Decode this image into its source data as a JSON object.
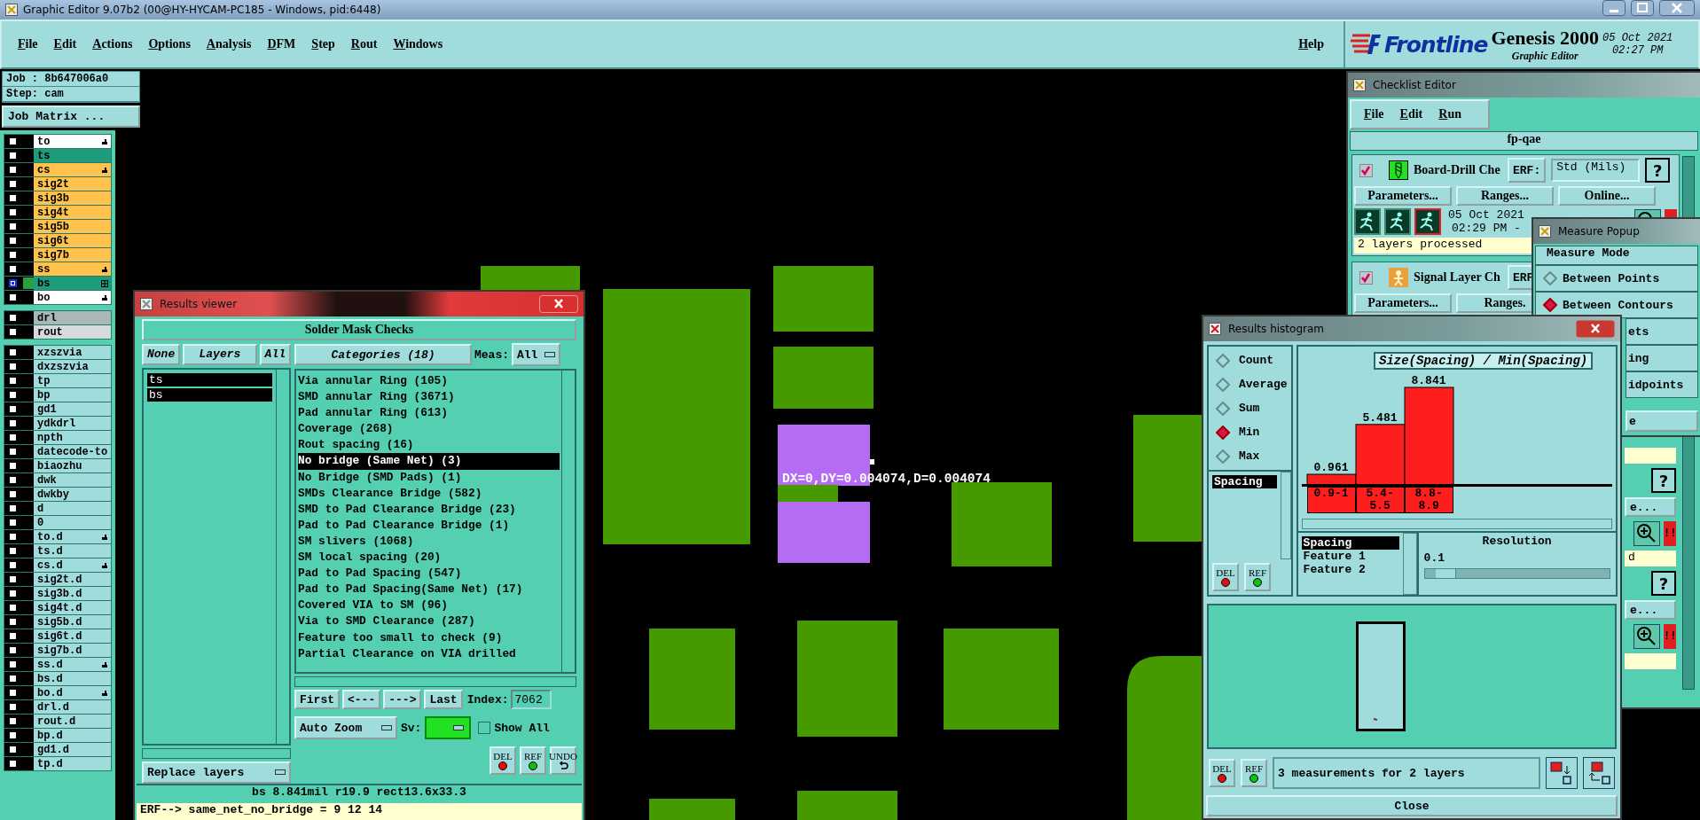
{
  "title_bar": {
    "title": "Graphic Editor 9.07b2 (00@HY-HYCAM-PC185 - Windows, pid:6448)"
  },
  "menu": [
    {
      "label": "File"
    },
    {
      "label": "Edit"
    },
    {
      "label": "Actions"
    },
    {
      "label": "Options"
    },
    {
      "label": "Analysis"
    },
    {
      "label": "DFM"
    },
    {
      "label": "Step"
    },
    {
      "label": "Rout"
    },
    {
      "label": "Windows"
    }
  ],
  "help": "Help",
  "brand": {
    "logo": "Frontline",
    "product": "Genesis 2000",
    "subtitle": "Graphic Editor",
    "date": "05 Oct 2021",
    "time": "02:27 PM"
  },
  "job": {
    "job": "Job : 8b647006a0",
    "step": "Step: cam",
    "matrix_button": "Job Matrix ..."
  },
  "layer_groups": [
    {
      "layers": [
        {
          "name": "to",
          "color": "#ffffff",
          "work": false,
          "kind": "pointer"
        },
        {
          "name": "ts",
          "color": "#1f9c7c",
          "work": false,
          "kind": "plain"
        },
        {
          "name": "cs",
          "color": "#ffc24d",
          "work": false,
          "kind": "pointer"
        },
        {
          "name": "sig2t",
          "color": "#ffc24d",
          "work": false,
          "kind": "plain"
        },
        {
          "name": "sig3b",
          "color": "#ffc24d",
          "work": false,
          "kind": "plain"
        },
        {
          "name": "sig4t",
          "color": "#ffc24d",
          "work": false,
          "kind": "plain"
        },
        {
          "name": "sig5b",
          "color": "#ffc24d",
          "work": false,
          "kind": "plain"
        },
        {
          "name": "sig6t",
          "color": "#ffc24d",
          "work": false,
          "kind": "plain"
        },
        {
          "name": "sig7b",
          "color": "#ffc24d",
          "work": false,
          "kind": "plain"
        },
        {
          "name": "ss",
          "color": "#ffc24d",
          "work": false,
          "kind": "pointer"
        },
        {
          "name": "bs",
          "color": "#1f9c7c",
          "work": true,
          "kind": "grid"
        },
        {
          "name": "bo",
          "color": "#ffffff",
          "work": false,
          "kind": "pointer"
        }
      ]
    },
    {
      "layers": [
        {
          "name": "drl",
          "color": "#a9b7b7",
          "work": false,
          "kind": "plain"
        },
        {
          "name": "rout",
          "color": "#d6dada",
          "work": false,
          "kind": "plain"
        }
      ]
    },
    {
      "layers": [
        {
          "name": "xzszvia",
          "color": "#a0dcdc",
          "work": false,
          "kind": "plain"
        },
        {
          "name": "dxzszvia",
          "color": "#a0dcdc",
          "work": false,
          "kind": "plain"
        },
        {
          "name": "tp",
          "color": "#a0dcdc",
          "work": false,
          "kind": "plain"
        },
        {
          "name": "bp",
          "color": "#a0dcdc",
          "work": false,
          "kind": "plain"
        },
        {
          "name": "gd1",
          "color": "#a0dcdc",
          "work": false,
          "kind": "plain"
        },
        {
          "name": "ydkdrl",
          "color": "#a0dcdc",
          "work": false,
          "kind": "plain"
        },
        {
          "name": "npth",
          "color": "#a0dcdc",
          "work": false,
          "kind": "plain"
        },
        {
          "name": "datecode-to",
          "color": "#a0dcdc",
          "work": false,
          "kind": "plain"
        },
        {
          "name": "biaozhu",
          "color": "#a0dcdc",
          "work": false,
          "kind": "plain"
        },
        {
          "name": "dwk",
          "color": "#a0dcdc",
          "work": false,
          "kind": "plain"
        },
        {
          "name": "dwkby",
          "color": "#a0dcdc",
          "work": false,
          "kind": "plain"
        },
        {
          "name": "d",
          "color": "#a0dcdc",
          "work": false,
          "kind": "plain"
        },
        {
          "name": "0",
          "color": "#a0dcdc",
          "work": false,
          "kind": "plain"
        },
        {
          "name": "to.d",
          "color": "#a0dcdc",
          "work": false,
          "kind": "pointer"
        },
        {
          "name": "ts.d",
          "color": "#a0dcdc",
          "work": false,
          "kind": "plain"
        },
        {
          "name": "cs.d",
          "color": "#a0dcdc",
          "work": false,
          "kind": "pointer"
        },
        {
          "name": "sig2t.d",
          "color": "#a0dcdc",
          "work": false,
          "kind": "plain"
        },
        {
          "name": "sig3b.d",
          "color": "#a0dcdc",
          "work": false,
          "kind": "plain"
        },
        {
          "name": "sig4t.d",
          "color": "#a0dcdc",
          "work": false,
          "kind": "plain"
        },
        {
          "name": "sig5b.d",
          "color": "#a0dcdc",
          "work": false,
          "kind": "plain"
        },
        {
          "name": "sig6t.d",
          "color": "#a0dcdc",
          "work": false,
          "kind": "plain"
        },
        {
          "name": "sig7b.d",
          "color": "#a0dcdc",
          "work": false,
          "kind": "plain"
        },
        {
          "name": "ss.d",
          "color": "#a0dcdc",
          "work": false,
          "kind": "pointer"
        },
        {
          "name": "bs.d",
          "color": "#a0dcdc",
          "work": false,
          "kind": "plain"
        },
        {
          "name": "bo.d",
          "color": "#a0dcdc",
          "work": false,
          "kind": "pointer"
        },
        {
          "name": "drl.d",
          "color": "#a0dcdc",
          "work": false,
          "kind": "plain"
        },
        {
          "name": "rout.d",
          "color": "#a0dcdc",
          "work": false,
          "kind": "plain"
        },
        {
          "name": "bp.d",
          "color": "#a0dcdc",
          "work": false,
          "kind": "plain"
        },
        {
          "name": "gd1.d",
          "color": "#a0dcdc",
          "work": false,
          "kind": "plain"
        },
        {
          "name": "tp.d",
          "color": "#a0dcdc",
          "work": false,
          "kind": "plain"
        }
      ]
    }
  ],
  "canvas": {
    "measurement": "DX=0,DY=0.004074,D=0.004074"
  },
  "results_viewer": {
    "title": "Results viewer",
    "heading": "Solder Mask Checks",
    "none_button": "None",
    "layers_button": "Layers",
    "all_button": "All",
    "categories_button": "Categories (18)",
    "meas_label": "Meas:",
    "meas_value": "All",
    "layers": [
      {
        "name": "ts",
        "selected": true
      },
      {
        "name": "bs",
        "selected": true
      }
    ],
    "categories": [
      {
        "label": "Via annular Ring (105)",
        "selected": false
      },
      {
        "label": "SMD annular Ring (3671)",
        "selected": false
      },
      {
        "label": "Pad annular Ring (613)",
        "selected": false
      },
      {
        "label": "Coverage (268)",
        "selected": false
      },
      {
        "label": "Rout spacing (16)",
        "selected": false
      },
      {
        "label": "No bridge (Same Net) (3)",
        "selected": true
      },
      {
        "label": "No Bridge (SMD Pads) (1)",
        "selected": false
      },
      {
        "label": "SMDs Clearance Bridge (582)",
        "selected": false
      },
      {
        "label": "SMD to Pad Clearance Bridge (23)",
        "selected": false
      },
      {
        "label": "Pad to Pad Clearance Bridge (1)",
        "selected": false
      },
      {
        "label": "SM slivers (1068)",
        "selected": false
      },
      {
        "label": "SM local spacing (20)",
        "selected": false
      },
      {
        "label": "Pad to Pad Spacing (547)",
        "selected": false
      },
      {
        "label": "Pad to Pad Spacing(Same Net) (17)",
        "selected": false
      },
      {
        "label": "Covered VIA to SM (96)",
        "selected": false
      },
      {
        "label": "Via to SMD Clearance (287)",
        "selected": false
      },
      {
        "label": "Feature too small to check (9)",
        "selected": false
      },
      {
        "label": "Partial Clearance on VIA drilled",
        "selected": false
      }
    ],
    "nav": [
      "First",
      "<---",
      "--->",
      "Last"
    ],
    "index_label": "Index:",
    "index_value": "7062",
    "zoom_mode": "Auto Zoom",
    "sv_label": "Sv:",
    "show_all": {
      "label": "Show All",
      "checked": false
    },
    "replace": "Replace layers",
    "tools": [
      {
        "label": "DEL",
        "kind": "del"
      },
      {
        "label": "REF",
        "kind": "ref"
      },
      {
        "label": "UNDO",
        "kind": "undo"
      }
    ],
    "status": "bs 8.841mil   r19.9   rect13.6x33.3",
    "erf": "ERF--> same_net_no_bridge = 9 12 14"
  },
  "checklist": {
    "title": "Checklist Editor",
    "menu": [
      "File",
      "Edit",
      "Run"
    ],
    "name": "fp-qae",
    "items": [
      {
        "checked": true,
        "kind": "drill",
        "name": "Board-Drill Che",
        "erf": "ERF:",
        "units": "Std (Mils)",
        "help": "?",
        "buttons": [
          "Parameters...",
          "Ranges...",
          "Online..."
        ],
        "date": "05 Oct 2021",
        "time": "02:29 PM -",
        "status": "2 layers processed"
      },
      {
        "checked": true,
        "kind": "signal",
        "name": "Signal Layer Ch",
        "erf": "ERF",
        "buttons": [
          "Parameters...",
          "Ranges."
        ]
      }
    ],
    "fragments": [
      {
        "kind": "status"
      },
      {
        "kind": "help",
        "text": "?"
      },
      {
        "kind": "button",
        "text": "e..."
      },
      {
        "kind": "tools",
        "text": "!!"
      },
      {
        "kind": "status",
        "text": "d"
      },
      {
        "kind": "help",
        "text": "?"
      },
      {
        "kind": "button",
        "text": "e..."
      },
      {
        "kind": "tools",
        "text": "!!"
      },
      {
        "kind": "status"
      }
    ]
  },
  "measure_popup": {
    "title": "Measure Popup",
    "heading": "Measure Mode",
    "modes": [
      {
        "kind": "radio",
        "label": "Between Points",
        "selected": false
      },
      {
        "kind": "radio",
        "label": "Between Contours",
        "selected": true
      },
      {
        "kind": "partial",
        "label": "ets"
      },
      {
        "kind": "partial",
        "label": "ing"
      },
      {
        "kind": "partial",
        "label": "idpoints"
      }
    ],
    "button": "e"
  },
  "histogram": {
    "title": "Results histogram",
    "stats": [
      {
        "label": "Count",
        "selected": false
      },
      {
        "label": "Average",
        "selected": false
      },
      {
        "label": "Sum",
        "selected": false
      },
      {
        "label": "Min",
        "selected": true
      },
      {
        "label": "Max",
        "selected": false
      }
    ],
    "measures": [
      {
        "label": "Spacing",
        "selected": true
      }
    ],
    "chart_data": {
      "type": "bar",
      "title": "Size(Spacing) / Min(Spacing)",
      "categories": [
        "0.9-1",
        "5.4-5.5",
        "8.8-8.9"
      ],
      "values": [
        0.961,
        5.481,
        8.841
      ],
      "data_labels": true
    },
    "fields": [
      {
        "label": "Spacing",
        "selected": true
      },
      {
        "label": "Feature 1",
        "selected": false
      },
      {
        "label": "Feature 2",
        "selected": false
      }
    ],
    "resolution": {
      "label": "Resolution",
      "value": "0.1",
      "level": 0.06
    },
    "list_tools": [
      {
        "label": "DEL",
        "kind": "del"
      },
      {
        "label": "REF",
        "kind": "ref"
      }
    ],
    "bottom_tools": [
      {
        "label": "DEL",
        "kind": "del"
      },
      {
        "label": "REF",
        "kind": "ref"
      }
    ],
    "summary": "3 measurements for 2 layers",
    "close": "Close"
  }
}
